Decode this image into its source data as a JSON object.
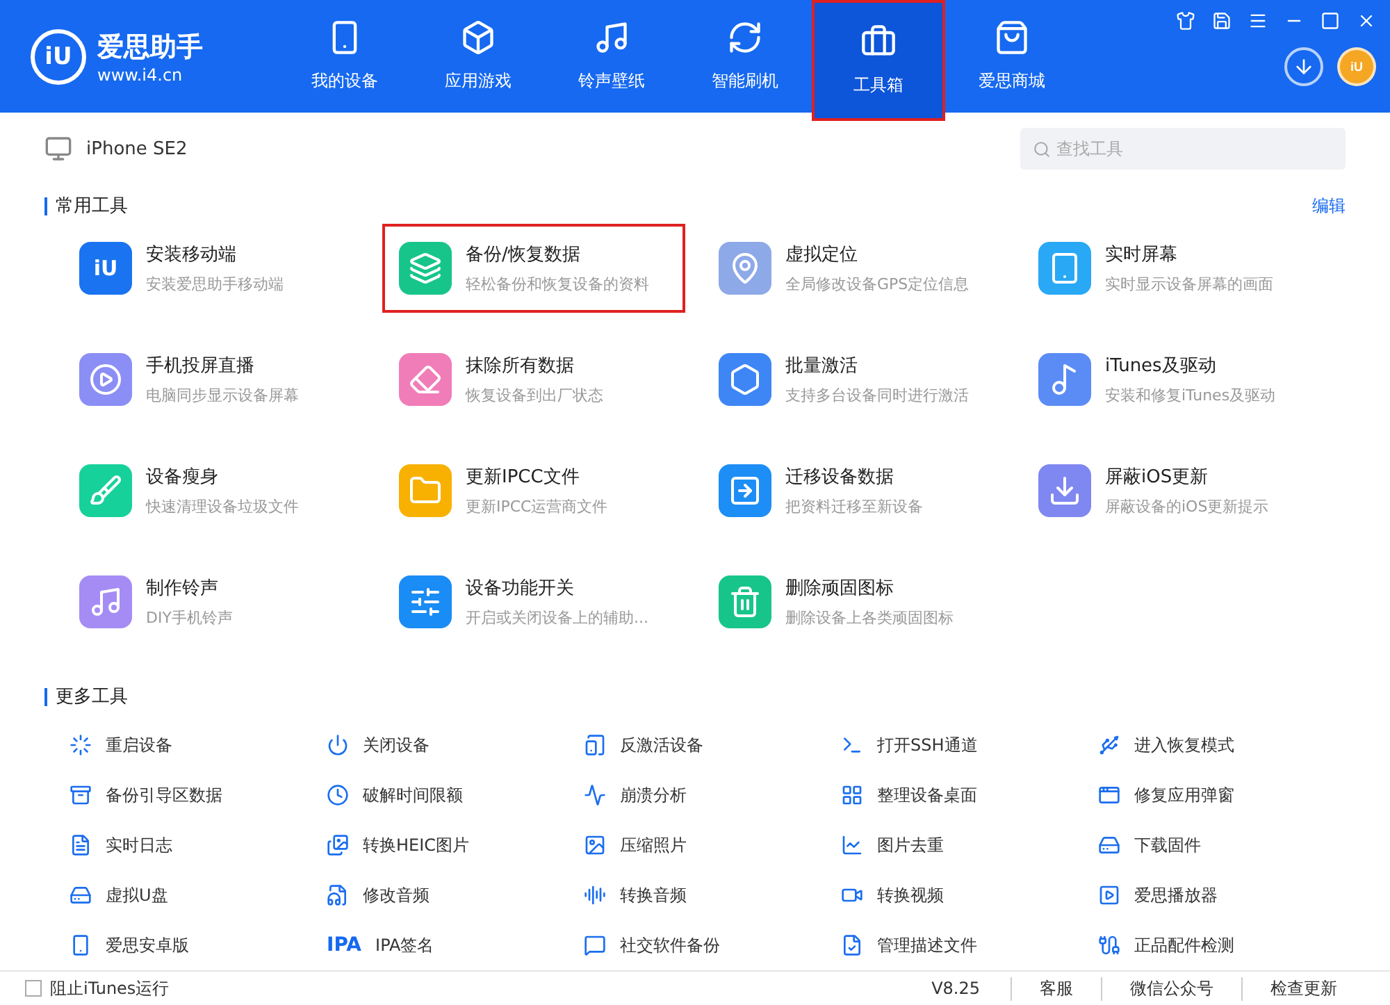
{
  "app": {
    "logo_mark": "iU",
    "name": "爱思助手",
    "url": "www.i4.cn"
  },
  "account": {
    "avatar_text": "iU"
  },
  "nav": [
    {
      "label": "我的设备",
      "selected": false,
      "highlighted": false
    },
    {
      "label": "应用游戏",
      "selected": false,
      "highlighted": false
    },
    {
      "label": "铃声壁纸",
      "selected": false,
      "highlighted": false
    },
    {
      "label": "智能刷机",
      "selected": false,
      "highlighted": false
    },
    {
      "label": "工具箱",
      "selected": true,
      "highlighted": true
    },
    {
      "label": "爱思商城",
      "selected": false,
      "highlighted": false
    }
  ],
  "device": {
    "name": "iPhone SE2"
  },
  "search": {
    "placeholder": "查找工具"
  },
  "common_tools": {
    "title": "常用工具",
    "action": "编辑",
    "items": [
      {
        "title": "安装移动端",
        "desc": "安装爱思助手移动端",
        "highlighted": false,
        "icon_text": "iU"
      },
      {
        "title": "备份/恢复数据",
        "desc": "轻松备份和恢复设备的资料",
        "highlighted": true
      },
      {
        "title": "虚拟定位",
        "desc": "全局修改设备GPS定位信息",
        "highlighted": false
      },
      {
        "title": "实时屏幕",
        "desc": "实时显示设备屏幕的画面",
        "highlighted": false
      },
      {
        "title": "手机投屏直播",
        "desc": "电脑同步显示设备屏幕",
        "highlighted": false
      },
      {
        "title": "抹除所有数据",
        "desc": "恢复设备到出厂状态",
        "highlighted": false
      },
      {
        "title": "批量激活",
        "desc": "支持多台设备同时进行激活",
        "highlighted": false
      },
      {
        "title": "iTunes及驱动",
        "desc": "安装和修复iTunes及驱动",
        "highlighted": false
      },
      {
        "title": "设备瘦身",
        "desc": "快速清理设备垃圾文件",
        "highlighted": false
      },
      {
        "title": "更新IPCC文件",
        "desc": "更新IPCC运营商文件",
        "highlighted": false
      },
      {
        "title": "迁移设备数据",
        "desc": "把资料迁移至新设备",
        "highlighted": false
      },
      {
        "title": "屏蔽iOS更新",
        "desc": "屏蔽设备的iOS更新提示",
        "highlighted": false
      },
      {
        "title": "制作铃声",
        "desc": "DIY手机铃声",
        "highlighted": false
      },
      {
        "title": "设备功能开关",
        "desc": "开启或关闭设备上的辅助...",
        "highlighted": false
      },
      {
        "title": "删除顽固图标",
        "desc": "删除设备上各类顽固图标",
        "highlighted": false
      }
    ]
  },
  "more_tools": {
    "title": "更多工具",
    "items": [
      {
        "label": "重启设备"
      },
      {
        "label": "关闭设备"
      },
      {
        "label": "反激活设备"
      },
      {
        "label": "打开SSH通道"
      },
      {
        "label": "进入恢复模式"
      },
      {
        "label": "备份引导区数据"
      },
      {
        "label": "破解时间限额"
      },
      {
        "label": "崩溃分析"
      },
      {
        "label": "整理设备桌面"
      },
      {
        "label": "修复应用弹窗"
      },
      {
        "label": "实时日志"
      },
      {
        "label": "转换HEIC图片"
      },
      {
        "label": "压缩照片"
      },
      {
        "label": "图片去重"
      },
      {
        "label": "下载固件"
      },
      {
        "label": "虚拟U盘"
      },
      {
        "label": "修改音频"
      },
      {
        "label": "转换音频"
      },
      {
        "label": "转换视频"
      },
      {
        "label": "爱思播放器"
      },
      {
        "label": "爱思安卓版"
      },
      {
        "label": "IPA签名",
        "badge": "IPA"
      },
      {
        "label": "社交软件备份"
      },
      {
        "label": "管理描述文件"
      },
      {
        "label": "正品配件检测"
      }
    ]
  },
  "footer": {
    "itunes_block": {
      "label": "阻止iTunes运行",
      "checked": false
    },
    "version": "V8.25",
    "links": [
      "客服",
      "微信公众号",
      "检查更新"
    ]
  }
}
